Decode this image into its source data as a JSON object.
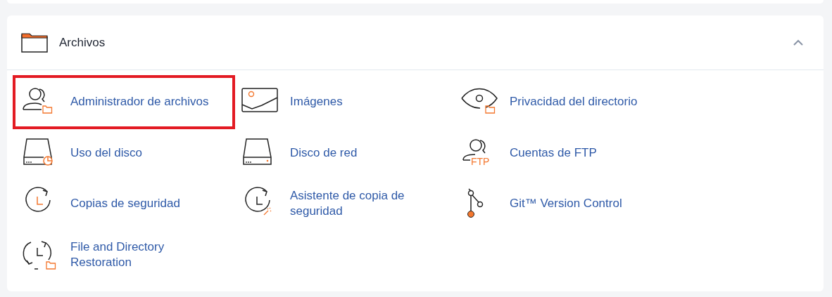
{
  "section": {
    "title": "Archivos",
    "expanded": true
  },
  "items": [
    {
      "label": "Administrador de archivos",
      "highlighted": true
    },
    {
      "label": "Imágenes",
      "highlighted": false
    },
    {
      "label": "Privacidad del directorio",
      "highlighted": false
    },
    {
      "label": "Uso del disco",
      "highlighted": false
    },
    {
      "label": "Disco de red",
      "highlighted": false
    },
    {
      "label": "Cuentas de FTP",
      "highlighted": false,
      "icon_text": "FTP"
    },
    {
      "label": "Copias de seguridad",
      "highlighted": false
    },
    {
      "label": "Asistente de copia de seguridad",
      "highlighted": false
    },
    {
      "label": "Git™ Version Control",
      "highlighted": false
    },
    {
      "label": "File and Directory Restoration",
      "highlighted": false
    }
  ]
}
